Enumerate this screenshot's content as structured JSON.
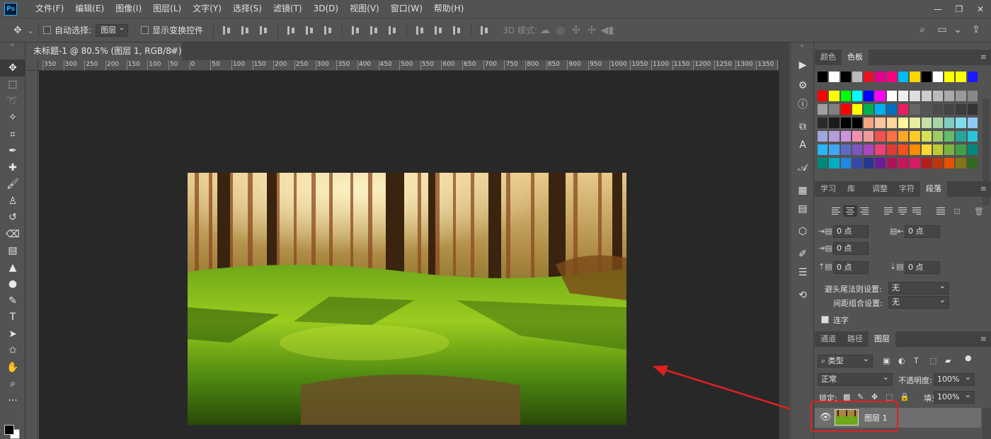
{
  "app": {
    "logo": "Ps",
    "menu": [
      "文件(F)",
      "编辑(E)",
      "图像(I)",
      "图层(L)",
      "文字(Y)",
      "选择(S)",
      "滤镜(T)",
      "3D(D)",
      "视图(V)",
      "窗口(W)",
      "帮助(H)"
    ]
  },
  "options": {
    "auto_select_label": "自动选择:",
    "auto_select_value": "图层",
    "show_transform_label": "显示变换控件",
    "mode_3d_label": "3D 模式:"
  },
  "document": {
    "tab_title": "未标题-1 @ 80.5% (图层 1, RGB/8#) *",
    "ruler_labels": [
      "350",
      "300",
      "250",
      "200",
      "150",
      "100",
      "50",
      "0",
      "50",
      "100",
      "150",
      "200",
      "250",
      "300",
      "350",
      "400",
      "450",
      "500",
      "550",
      "600",
      "650",
      "700",
      "750",
      "800",
      "850",
      "900",
      "950",
      "1000",
      "1050",
      "1100",
      "1150",
      "1200",
      "1250",
      "1300",
      "1350",
      "14"
    ]
  },
  "swatches_panel": {
    "tabs": [
      "颜色",
      "色板"
    ],
    "active_tab": "色板",
    "rows": [
      [
        "#000000",
        "#ffffff",
        "#000000",
        "#bbbbbb",
        "#e81123",
        "#e3008c",
        "#ff0080",
        "#00bcf2",
        "#ffd700",
        "#000000",
        "#ffffff",
        "#ffff00",
        "#f7ff00",
        "#1a1aff"
      ],
      [
        "#ff0000",
        "#ffff00",
        "#00ff00",
        "#00ffff",
        "#0000ff",
        "#ff00ff",
        "#ffffff",
        "#eeeeee",
        "#dddddd",
        "#cccccc",
        "#bbbbbb",
        "#aaaaaa",
        "#999999",
        "#888888"
      ],
      [
        "#a0a0a0",
        "#808080",
        "#ff0000",
        "#ffff00",
        "#00b050",
        "#00b0f0",
        "#0070c0",
        "#e91e63",
        "#666666",
        "#555555",
        "#4a4a4a",
        "#444444",
        "#3c3c3c",
        "#333333"
      ],
      [
        "#2a2a2a",
        "#1a1a1a",
        "#000000",
        "#000000",
        "#f4a582",
        "#f7c59f",
        "#ffd59a",
        "#fff59d",
        "#e6ee9c",
        "#c5e1a5",
        "#a5d6a7",
        "#80cbc4",
        "#80deea",
        "#90caf9"
      ],
      [
        "#9fa8da",
        "#b39ddb",
        "#ce93d8",
        "#f48fb1",
        "#ef9a9a",
        "#ef5350",
        "#ff7043",
        "#ffa726",
        "#ffca28",
        "#d4e157",
        "#9ccc65",
        "#66bb6a",
        "#26a69a",
        "#26c6da"
      ],
      [
        "#29b6f6",
        "#42a5f5",
        "#5c6bc0",
        "#7e57c2",
        "#ab47bc",
        "#ec407a",
        "#e53935",
        "#f4511e",
        "#fb8c00",
        "#fdd835",
        "#c0ca33",
        "#7cb342",
        "#43a047",
        "#00897b"
      ],
      [
        "#00897b",
        "#00acc1",
        "#1e88e5",
        "#3949ab",
        "#283593",
        "#6a1b9a",
        "#ad1457",
        "#c2185b",
        "#d81b60",
        "#b71c1c",
        "#bf360c",
        "#e65100",
        "#827717",
        "#33691e"
      ]
    ]
  },
  "paragraph_panel": {
    "tabs": [
      "学习",
      "库",
      "调整",
      "字符",
      "段落"
    ],
    "active_tab": "段落",
    "indent_left": "0 点",
    "indent_right": "0 点",
    "indent_first": "0 点",
    "space_before": "0 点",
    "space_after": "0 点",
    "hyphen_label": "避头尾法则设置:",
    "hyphen_value": "无",
    "spacing_label": "间距组合设置:",
    "spacing_value": "无",
    "hyphenate_label": "连字"
  },
  "layers_panel": {
    "tabs": [
      "通道",
      "路径",
      "图层"
    ],
    "active_tab": "图层",
    "filter_type": "类型",
    "blend_mode": "正常",
    "opacity_label": "不透明度:",
    "opacity_value": "100%",
    "lock_label": "锁定:",
    "fill_label": "填充:",
    "fill_value": "100%",
    "layers": [
      {
        "name": "图层 1",
        "visible": true
      }
    ]
  },
  "colors": {
    "accent": "#e02020",
    "canvas_bg": "#282828",
    "panel_bg": "#535353"
  }
}
